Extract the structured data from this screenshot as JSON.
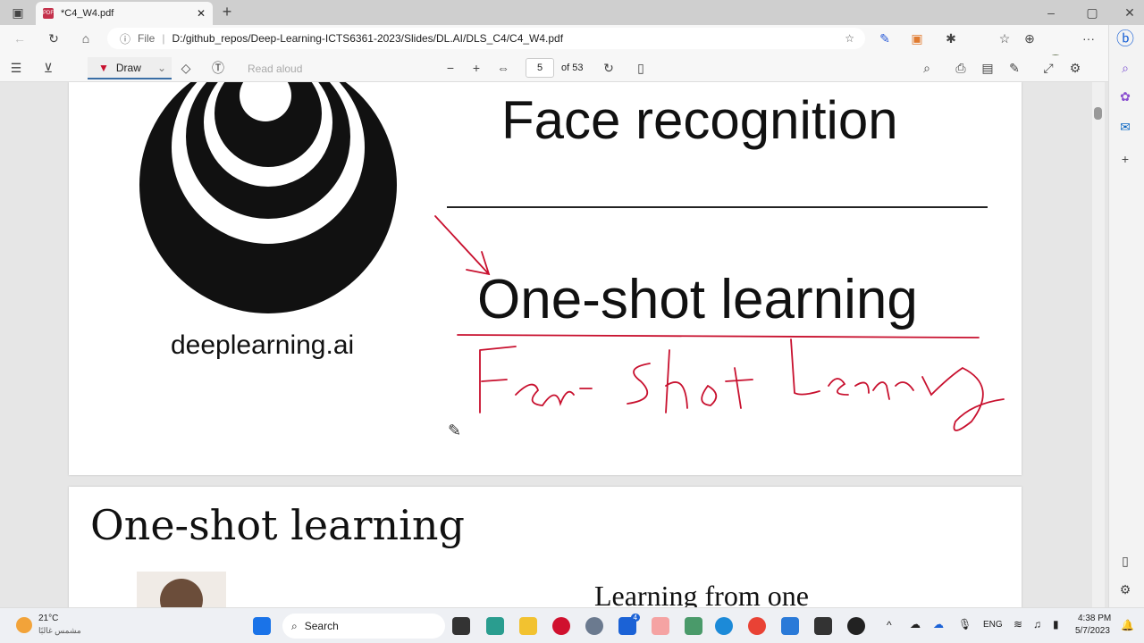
{
  "tab": {
    "title": "*C4_W4.pdf",
    "new_tab": "+"
  },
  "window": {
    "minimize": "–",
    "maximize": "▢",
    "close": "✕"
  },
  "address": {
    "scheme": "File",
    "url": "D:/github_repos/Deep-Learning-ICTS6361-2023/Slides/DL.AI/DLS_C4/C4_W4.pdf"
  },
  "pdf_toolbar": {
    "draw": "Draw",
    "read_aloud": "Read aloud",
    "page": "5",
    "of_pages": "of 53"
  },
  "slide1": {
    "title": "Face recognition",
    "subtitle": "One-shot learning",
    "logo_text": "deeplearning.ai",
    "handwriting": "Few-Shot Learning"
  },
  "slide2": {
    "title": "One-shot learning",
    "text": "Learning from one"
  },
  "taskbar": {
    "temp": "21°C",
    "weather": "مشمس غالبًا",
    "search": "Search",
    "lang": "ENG",
    "time": "4:38 PM",
    "date": "5/7/2023",
    "mail_badge": "4"
  },
  "colors": {
    "ink": "#c8102e",
    "accent": "#3a6ea5"
  }
}
